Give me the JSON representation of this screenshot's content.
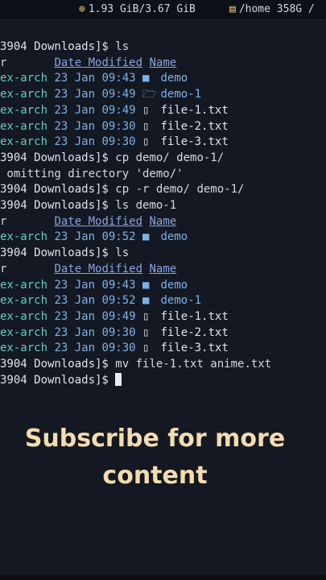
{
  "status_bar": {
    "memory_icon": "chip-icon",
    "memory": "1.93 GiB/3.67 GiB",
    "disk_icon": "database-icon",
    "disk": "/home 358G /"
  },
  "terminal": {
    "prompt": "3904 Downloads]$ ",
    "commands": [
      "ls",
      "cp demo/ demo-1/",
      "cp -r demo/ demo-1/",
      "ls demo-1",
      "ls",
      "mv file-1.txt anime.txt",
      ""
    ],
    "header": {
      "owner_fragment": "r",
      "date_col": "Date Modified",
      "name_col": "Name"
    },
    "owner_fragment": "ex-arch",
    "error_text": " omitting directory 'demo/'",
    "listing_1": [
      {
        "date": "23 Jan 09:43",
        "icon": "folder-icon",
        "name": "demo",
        "type": "dir"
      },
      {
        "date": "23 Jan 09:49",
        "icon": "folder-open-icon",
        "name": "demo-1",
        "type": "dir"
      },
      {
        "date": "23 Jan 09:49",
        "icon": "file-icon",
        "name": "file-1.txt",
        "type": "file"
      },
      {
        "date": "23 Jan 09:30",
        "icon": "file-icon",
        "name": "file-2.txt",
        "type": "file"
      },
      {
        "date": "23 Jan 09:30",
        "icon": "file-icon",
        "name": "file-3.txt",
        "type": "file"
      }
    ],
    "listing_2": [
      {
        "date": "23 Jan 09:52",
        "icon": "folder-icon",
        "name": "demo",
        "type": "dir"
      }
    ],
    "listing_3": [
      {
        "date": "23 Jan 09:43",
        "icon": "folder-icon",
        "name": "demo",
        "type": "dir"
      },
      {
        "date": "23 Jan 09:52",
        "icon": "folder-icon",
        "name": "demo-1",
        "type": "dir"
      },
      {
        "date": "23 Jan 09:49",
        "icon": "file-icon",
        "name": "file-1.txt",
        "type": "file"
      },
      {
        "date": "23 Jan 09:30",
        "icon": "file-icon",
        "name": "file-2.txt",
        "type": "file"
      },
      {
        "date": "23 Jan 09:30",
        "icon": "file-icon",
        "name": "file-3.txt",
        "type": "file"
      }
    ]
  },
  "overlay": {
    "caption": "Subscribe for more content"
  }
}
